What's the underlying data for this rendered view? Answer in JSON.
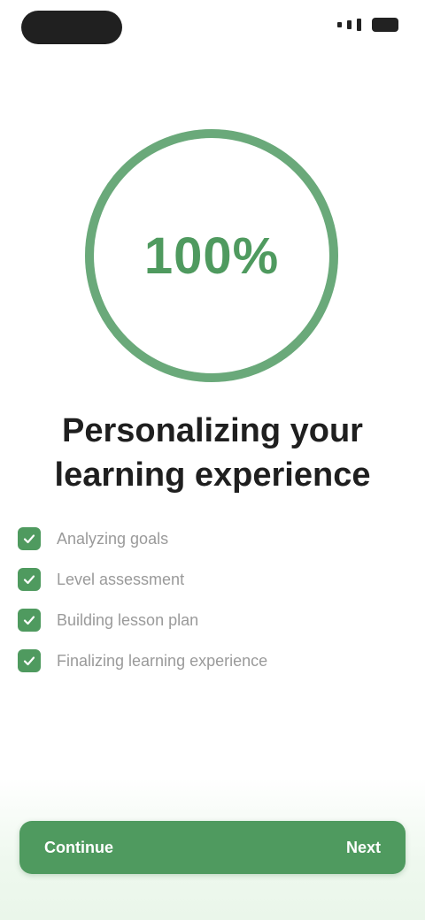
{
  "progress": {
    "percent_text": "100%",
    "value": 1.0
  },
  "title": "Personalizing your learning experience",
  "checklist": [
    {
      "label": "Analyzing goals"
    },
    {
      "label": "Level assessment"
    },
    {
      "label": "Building lesson plan"
    },
    {
      "label": "Finalizing learning experience"
    }
  ],
  "cta": {
    "label": "Continue",
    "right_text": "Next"
  },
  "colors": {
    "accent": "#4f9a5f",
    "ring_track": "#d7eadb",
    "button": "#4f9a5f"
  },
  "icons": {
    "check": "check-icon",
    "signal": "signal-icon",
    "battery": "battery-icon"
  }
}
